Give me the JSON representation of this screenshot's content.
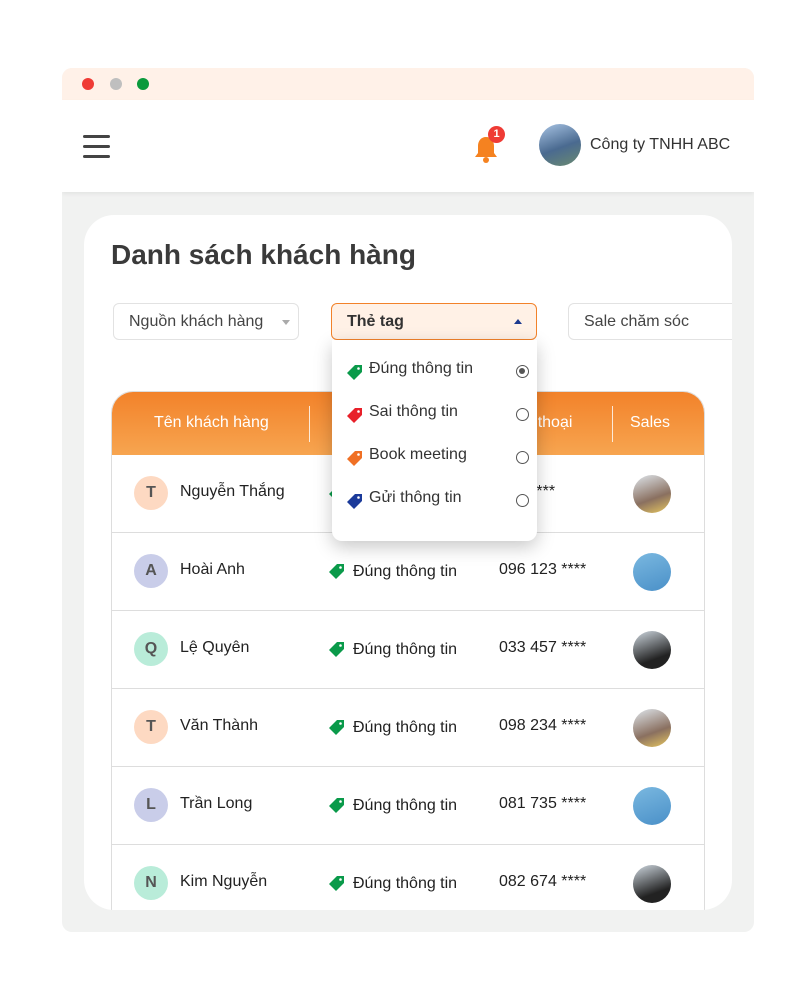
{
  "window": {
    "dots": [
      "#ef3b35",
      "#bfbfbf",
      "#0a9a3c"
    ]
  },
  "header": {
    "notification_count": "1",
    "company_name": "Công ty TNHH ABC"
  },
  "page": {
    "title": "Danh sách khách hàng"
  },
  "filters": {
    "source": "Nguồn khách hàng",
    "tag": "Thẻ tag",
    "sale": "Sale chăm sóc"
  },
  "tag_dropdown": {
    "options": [
      {
        "label": "Đúng thông tin",
        "color": "#0a9a4a",
        "selected": true
      },
      {
        "label": "Sai thông tin",
        "color": "#e8202a",
        "selected": false
      },
      {
        "label": "Book meeting",
        "color": "#f07024",
        "selected": false
      },
      {
        "label": "Gửi thông tin",
        "color": "#1b3a9a",
        "selected": false
      }
    ]
  },
  "table": {
    "columns": [
      "Tên khách hàng",
      "",
      "Số điện thoại",
      "Sales"
    ],
    "rows": [
      {
        "initial": "T",
        "name": "Nguyễn Thắng",
        "tag": "Đúng thông tin",
        "phone": "154 ****",
        "color": "#fdd9c2"
      },
      {
        "initial": "A",
        "name": "Hoài Anh",
        "tag": "Đúng thông tin",
        "phone": "096 123 ****",
        "color": "#c9cde9"
      },
      {
        "initial": "Q",
        "name": "Lệ Quyên",
        "tag": "Đúng thông tin",
        "phone": "033 457 ****",
        "color": "#b9ecd9"
      },
      {
        "initial": "T",
        "name": "Văn Thành",
        "tag": "Đúng thông tin",
        "phone": "098 234 ****",
        "color": "#fdd9c2"
      },
      {
        "initial": "L",
        "name": "Trần Long",
        "tag": "Đúng thông tin",
        "phone": "081 735 ****",
        "color": "#c9cde9"
      },
      {
        "initial": "N",
        "name": "Kim Nguyễn",
        "tag": "Đúng thông tin",
        "phone": "082 674 ****",
        "color": "#b9ecd9"
      }
    ]
  },
  "colors": {
    "accent": "#f2822a",
    "tag_green": "#0a9a4a"
  }
}
